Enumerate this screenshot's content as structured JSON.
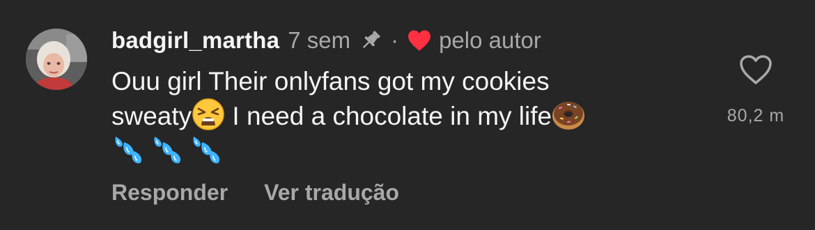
{
  "comment": {
    "username": "badgirl_martha",
    "time_ago": "7 sem",
    "separator": "·",
    "author_like_label": "pelo autor",
    "text_line1": "Ouu girl Their onlyfans got my cookies",
    "text_line2a": "sweaty",
    "text_line2b": " I need a chocolate in my life",
    "emojis": [
      "weary-face-emoji",
      "doughnut-emoji",
      "sweat-droplets-emoji"
    ],
    "like_count": "80,2 m"
  },
  "actions": {
    "reply_label": "Responder",
    "translate_label": "Ver tradução"
  },
  "colors": {
    "background": "#262626",
    "primary_text": "#f5f5f5",
    "secondary_text": "#a8a8a8",
    "heart_red": "#ff3040"
  }
}
